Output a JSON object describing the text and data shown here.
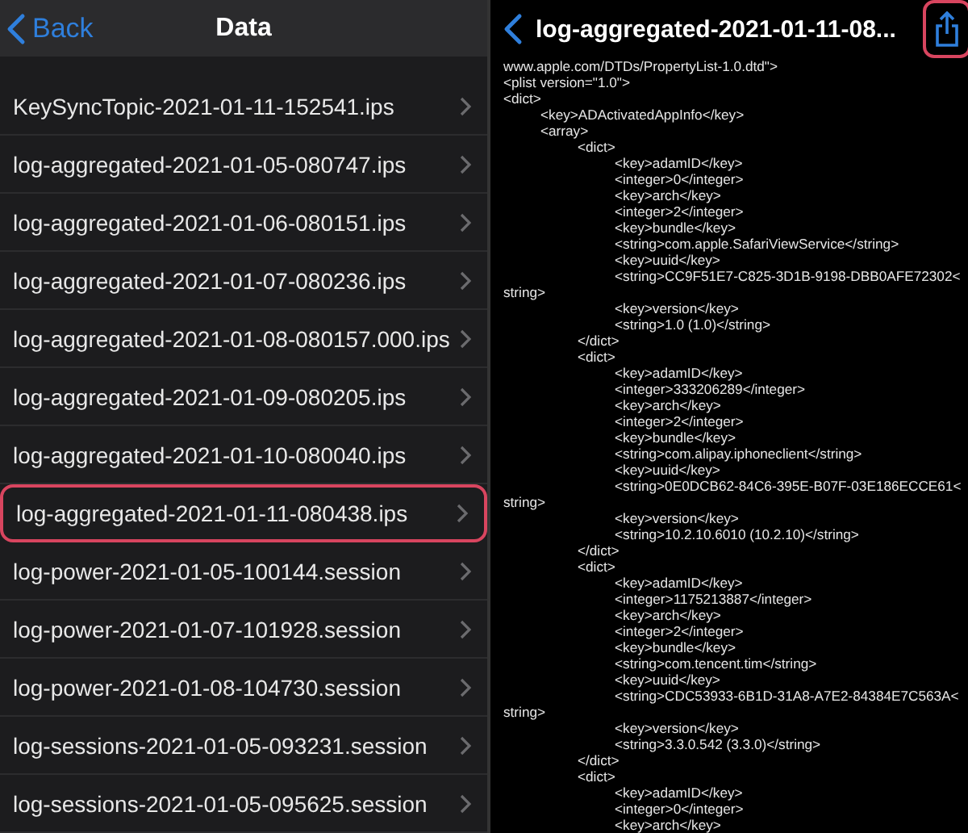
{
  "files_screen": {
    "nav": {
      "back": "Back",
      "title": "Data"
    },
    "rows": [
      {
        "label": "KeySyncTopic-2021-01-11-152541.ips",
        "highlighted": false
      },
      {
        "label": "log-aggregated-2021-01-05-080747.ips",
        "highlighted": false
      },
      {
        "label": "log-aggregated-2021-01-06-080151.ips",
        "highlighted": false
      },
      {
        "label": "log-aggregated-2021-01-07-080236.ips",
        "highlighted": false
      },
      {
        "label": "log-aggregated-2021-01-08-080157.000.ips",
        "highlighted": false
      },
      {
        "label": "log-aggregated-2021-01-09-080205.ips",
        "highlighted": false
      },
      {
        "label": "log-aggregated-2021-01-10-080040.ips",
        "highlighted": false
      },
      {
        "label": "log-aggregated-2021-01-11-080438.ips",
        "highlighted": true
      },
      {
        "label": "log-power-2021-01-05-100144.session",
        "highlighted": false
      },
      {
        "label": "log-power-2021-01-07-101928.session",
        "highlighted": false
      },
      {
        "label": "log-power-2021-01-08-104730.session",
        "highlighted": false
      },
      {
        "label": "log-sessions-2021-01-05-093231.session",
        "highlighted": false
      },
      {
        "label": "log-sessions-2021-01-05-095625.session",
        "highlighted": false
      }
    ]
  },
  "viewer_screen": {
    "nav": {
      "title": "log-aggregated-2021-01-11-08...",
      "share_highlighted": true
    },
    "lines": [
      {
        "text": "www.apple.com/DTDs/PropertyList-1.0.dtd\">"
      },
      {
        "text": "<plist version=\"1.0\">"
      },
      {
        "text": "<dict>",
        "children": [
          {
            "text": "<key>ADActivatedAppInfo</key>"
          },
          {
            "text": "<array>",
            "children": [
              {
                "text": "<dict>",
                "children": [
                  {
                    "text": "<key>adamID</key>"
                  },
                  {
                    "text": "<integer>0</integer>"
                  },
                  {
                    "text": "<key>arch</key>"
                  },
                  {
                    "text": "<integer>2</integer>"
                  },
                  {
                    "text": "<key>bundle</key>"
                  },
                  {
                    "text": "<string>com.apple.SafariViewService</string>"
                  },
                  {
                    "text": "<key>uuid</key>"
                  },
                  {
                    "text": "<string>CC9F51E7-C825-3D1B-9198-DBB0AFE72302<",
                    "wrap": "string>"
                  },
                  {
                    "text": "<key>version</key>"
                  },
                  {
                    "text": "<string>1.0 (1.0)</string>"
                  }
                ]
              },
              {
                "text": "</dict>"
              },
              {
                "text": "<dict>",
                "children": [
                  {
                    "text": "<key>adamID</key>"
                  },
                  {
                    "text": "<integer>333206289</integer>"
                  },
                  {
                    "text": "<key>arch</key>"
                  },
                  {
                    "text": "<integer>2</integer>"
                  },
                  {
                    "text": "<key>bundle</key>"
                  },
                  {
                    "text": "<string>com.alipay.iphoneclient</string>"
                  },
                  {
                    "text": "<key>uuid</key>"
                  },
                  {
                    "text": "<string>0E0DCB62-84C6-395E-B07F-03E186ECCE61<",
                    "wrap": "string>"
                  },
                  {
                    "text": "<key>version</key>"
                  },
                  {
                    "text": "<string>10.2.10.6010 (10.2.10)</string>"
                  }
                ]
              },
              {
                "text": "</dict>"
              },
              {
                "text": "<dict>",
                "children": [
                  {
                    "text": "<key>adamID</key>"
                  },
                  {
                    "text": "<integer>1175213887</integer>"
                  },
                  {
                    "text": "<key>arch</key>"
                  },
                  {
                    "text": "<integer>2</integer>"
                  },
                  {
                    "text": "<key>bundle</key>"
                  },
                  {
                    "text": "<string>com.tencent.tim</string>"
                  },
                  {
                    "text": "<key>uuid</key>"
                  },
                  {
                    "text": "<string>CDC53933-6B1D-31A8-A7E2-84384E7C563A<",
                    "wrap": "string>"
                  },
                  {
                    "text": "<key>version</key>"
                  },
                  {
                    "text": "<string>3.3.0.542 (3.3.0)</string>"
                  }
                ]
              },
              {
                "text": "</dict>"
              },
              {
                "text": "<dict>",
                "children": [
                  {
                    "text": "<key>adamID</key>"
                  },
                  {
                    "text": "<integer>0</integer>"
                  },
                  {
                    "text": "<key>arch</key>"
                  }
                ]
              }
            ]
          }
        ]
      }
    ]
  }
}
